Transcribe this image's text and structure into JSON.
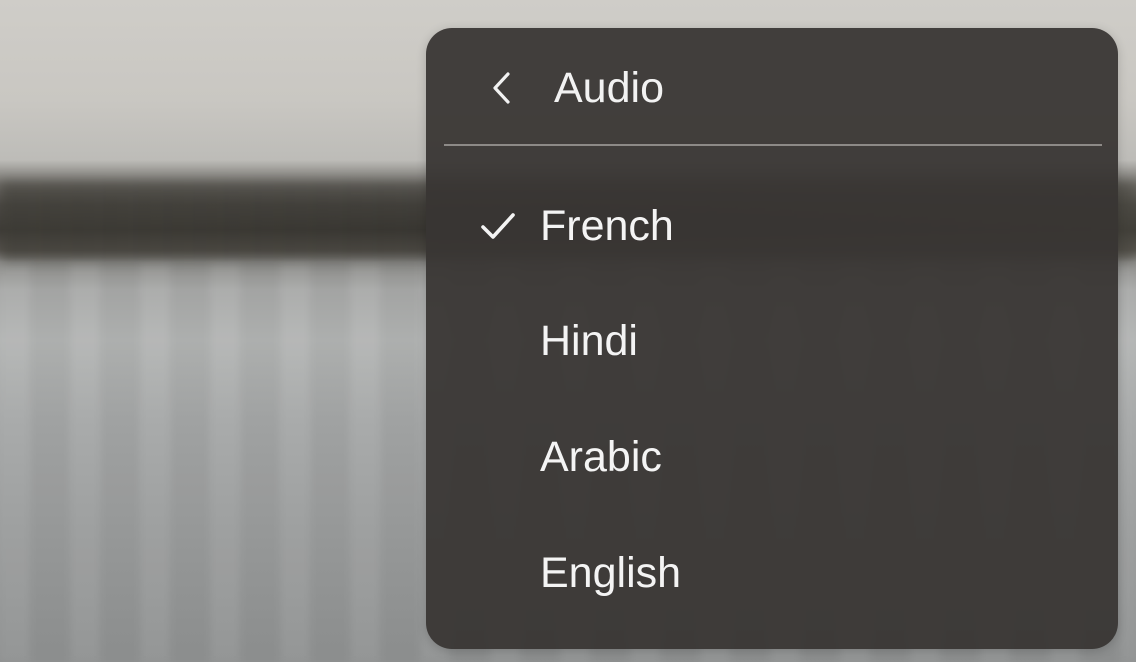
{
  "video": {
    "background_scene": "lake"
  },
  "audio_menu": {
    "title": "Audio",
    "back_icon": "chevron-left-icon",
    "check_icon": "checkmark-icon",
    "selected": "French",
    "options": [
      {
        "label": "French",
        "selected": true
      },
      {
        "label": "Hindi",
        "selected": false
      },
      {
        "label": "Arabic",
        "selected": false
      },
      {
        "label": "English",
        "selected": false
      }
    ]
  },
  "colors": {
    "menu_background": "#383533",
    "text": "#f4f4f4",
    "divider": "#8d8a87"
  }
}
